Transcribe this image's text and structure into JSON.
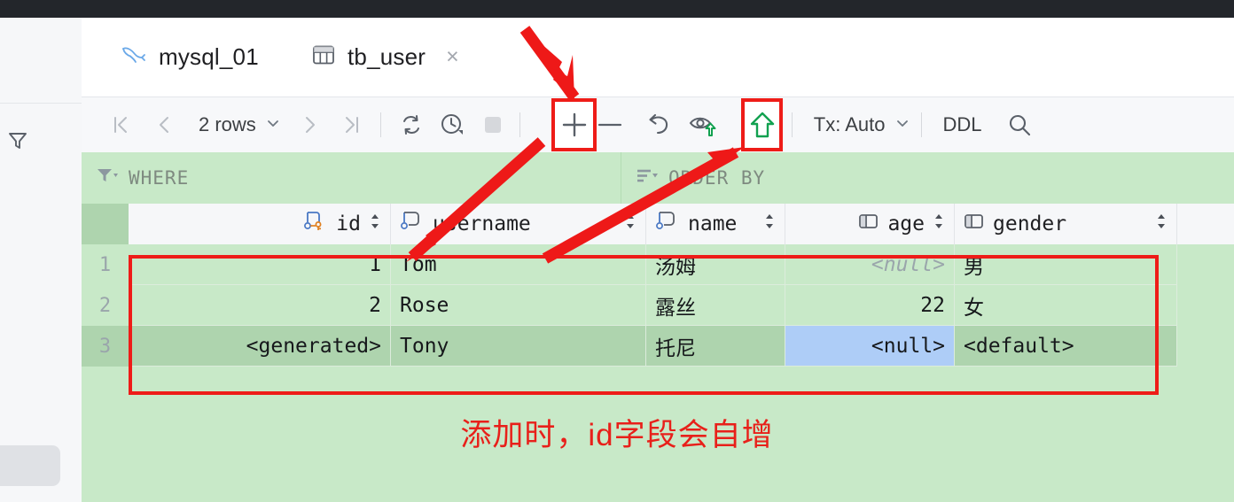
{
  "window": {
    "tabs": [
      {
        "label": "mysql_01",
        "icon": "dolphin-icon",
        "active": false,
        "closable": false
      },
      {
        "label": "tb_user",
        "icon": "table-icon",
        "active": true,
        "closable": true
      }
    ],
    "close_glyph": "×"
  },
  "sidebar": {
    "filter_icon": "filter-icon"
  },
  "toolbar": {
    "first_page": "|<",
    "prev_page": "‹",
    "rows_label": "2 rows",
    "rows_chevron": "∨",
    "next_page": "›",
    "last_page": ">|",
    "reload_icon": "refresh-icon",
    "history_icon": "history-clock-icon",
    "stop_icon": "stop-square-icon",
    "add_row_label": "+",
    "delete_row_label": "—",
    "revert_icon": "undo-arrow-icon",
    "preview_icon": "eye-upload-icon",
    "submit_icon": "upload-arrow-icon",
    "tx_label": "Tx: Auto",
    "tx_chevron": "∨",
    "ddl_label": "DDL",
    "search_icon": "search-icon"
  },
  "filter_bar": {
    "where_icon": "filter-dropdown-icon",
    "where_label": "WHERE",
    "order_icon": "sort-dropdown-icon",
    "order_label": "ORDER BY"
  },
  "grid": {
    "columns": [
      {
        "name": "id",
        "icon": "primary-key-column-icon",
        "align": "right",
        "sortable": true
      },
      {
        "name": "username",
        "icon": "column-icon",
        "align": "left",
        "sortable": true
      },
      {
        "name": "name",
        "icon": "column-icon",
        "align": "left",
        "sortable": true
      },
      {
        "name": "age",
        "icon": "plain-column-icon",
        "align": "right",
        "sortable": true
      },
      {
        "name": "gender",
        "icon": "plain-column-icon",
        "align": "left",
        "sortable": true
      }
    ],
    "rows": [
      {
        "num": "1",
        "selected": false,
        "cells": [
          {
            "value": "1",
            "null": false,
            "focus": false
          },
          {
            "value": "Tom",
            "null": false,
            "focus": false
          },
          {
            "value": "汤姆",
            "null": false,
            "focus": false
          },
          {
            "value": "<null>",
            "null": true,
            "focus": false
          },
          {
            "value": "男",
            "null": false,
            "focus": false
          }
        ]
      },
      {
        "num": "2",
        "selected": false,
        "cells": [
          {
            "value": "2",
            "null": false,
            "focus": false
          },
          {
            "value": "Rose",
            "null": false,
            "focus": false
          },
          {
            "value": "露丝",
            "null": false,
            "focus": false
          },
          {
            "value": "22",
            "null": false,
            "focus": false
          },
          {
            "value": "女",
            "null": false,
            "focus": false
          }
        ]
      },
      {
        "num": "3",
        "selected": true,
        "cells": [
          {
            "value": "<generated>",
            "null": false,
            "focus": false
          },
          {
            "value": "Tony",
            "null": false,
            "focus": false
          },
          {
            "value": "托尼",
            "null": false,
            "focus": false
          },
          {
            "value": "<null>",
            "null": false,
            "focus": true
          },
          {
            "value": "<default>",
            "null": false,
            "focus": false
          }
        ]
      }
    ]
  },
  "annotation": {
    "text": "添加时，id字段会自增",
    "color": "#e8201a"
  },
  "highlights": {
    "add_row_button": "red-box-around-add-row-button",
    "submit_button": "red-box-around-submit-button",
    "new_rows_region": "red-box-around-data-rows"
  },
  "colors": {
    "accent_tab": "#3574f0",
    "grid_green": "#c8e9c8",
    "grid_green_selected": "#aed4ae",
    "focus_blue": "#aecdf7",
    "annotation_red": "#e8201a",
    "dark_strip": "#23262b"
  }
}
